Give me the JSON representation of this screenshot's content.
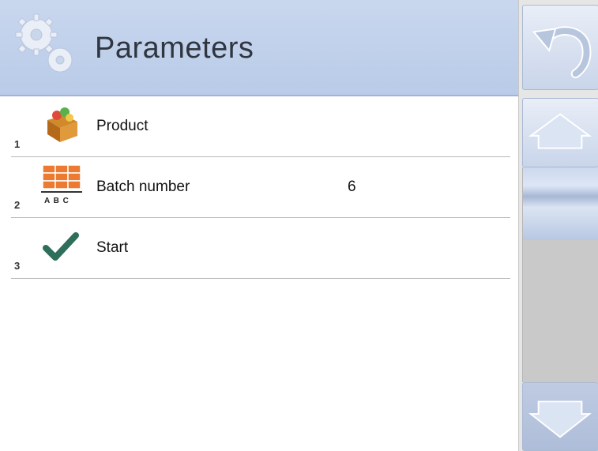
{
  "header": {
    "title": "Parameters",
    "icon": "gears-icon"
  },
  "items": [
    {
      "number": "1",
      "label": "Product",
      "value": "",
      "icon": "product-box-icon"
    },
    {
      "number": "2",
      "label": "Batch number",
      "value": "6",
      "icon": "batch-grid-icon",
      "icon_caption": "A B C"
    },
    {
      "number": "3",
      "label": "Start",
      "value": "",
      "icon": "checkmark-icon"
    }
  ],
  "sidebar": {
    "back_icon": "undo-arrow-icon",
    "up_icon": "arrow-up-icon",
    "down_icon": "arrow-down-icon"
  },
  "colors": {
    "header_bg": "#c4d3ec",
    "accent": "#b9cbe8",
    "check_green": "#2e6e5a",
    "batch_orange": "#e8702a"
  }
}
